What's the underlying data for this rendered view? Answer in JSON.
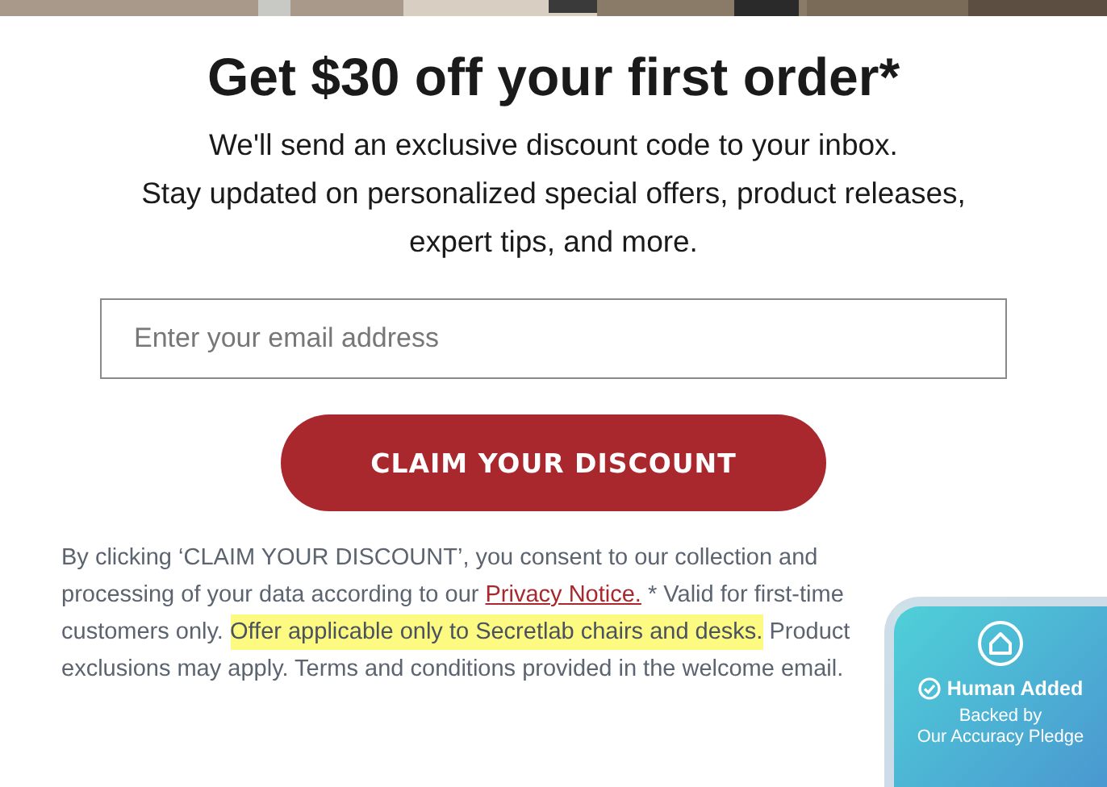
{
  "heading": "Get $30 off your first order*",
  "subtitle": [
    "We'll send an exclusive discount code to your inbox.",
    "Stay updated on personalized special offers, product releases,",
    "expert tips, and more."
  ],
  "email": {
    "placeholder": "Enter your email address"
  },
  "button": "CLAIM YOUR DISCOUNT",
  "disclaimer": [
    {
      "kind": "text",
      "text": "By clicking ‘CLAIM YOUR DISCOUNT’, you consent to our collection and processing of your data according to our "
    },
    {
      "kind": "link",
      "text": "Privacy Notice."
    },
    {
      "kind": "text",
      "text": " * Valid for first-time customers only. "
    },
    {
      "kind": "highlight",
      "text": "Offer applicable only to Secretlab chairs and desks."
    },
    {
      "kind": "text",
      "text": " Product exclusions may apply. Terms and conditions provided in the welcome email."
    }
  ],
  "badge": {
    "title": "Human Added",
    "lines": [
      "Backed by",
      "Our Accuracy Pledge"
    ]
  }
}
